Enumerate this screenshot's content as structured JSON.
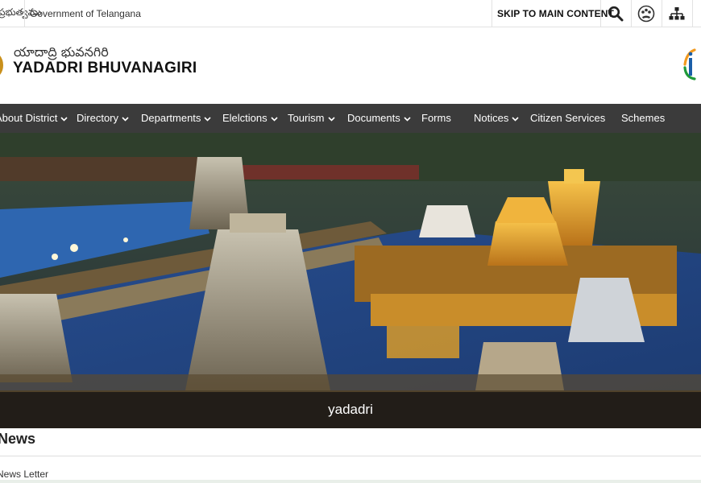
{
  "topbar": {
    "telugu_govt": "ప్రభుత్వము",
    "govt_label": "Government of Telangana",
    "skip_label": "SKIP TO MAIN CONTENT",
    "icons": [
      "search-icon",
      "accessibility-icon",
      "sitemap-icon"
    ]
  },
  "header": {
    "telugu_title": "యాదాద్రి భువనగిరి",
    "site_title": "YADADRI BHUVANAGIRI"
  },
  "nav": {
    "items": [
      {
        "label": "About District",
        "dropdown": true
      },
      {
        "label": "Directory",
        "dropdown": true
      },
      {
        "label": "Departments",
        "dropdown": true
      },
      {
        "label": "Elelctions",
        "dropdown": true
      },
      {
        "label": "Tourism",
        "dropdown": true
      },
      {
        "label": "Documents",
        "dropdown": true
      },
      {
        "label": "Forms",
        "dropdown": false
      },
      {
        "label": "Notices",
        "dropdown": true
      },
      {
        "label": "Citizen Services",
        "dropdown": false
      },
      {
        "label": "Schemes",
        "dropdown": false
      }
    ]
  },
  "banner": {
    "caption": "yadadri"
  },
  "news": {
    "title": "News",
    "first_item": "News Letter"
  },
  "colors": {
    "nav_bg": "#3b3b3b",
    "accent_saffron": "#f29a1f",
    "accent_green": "#1f9a3a"
  }
}
